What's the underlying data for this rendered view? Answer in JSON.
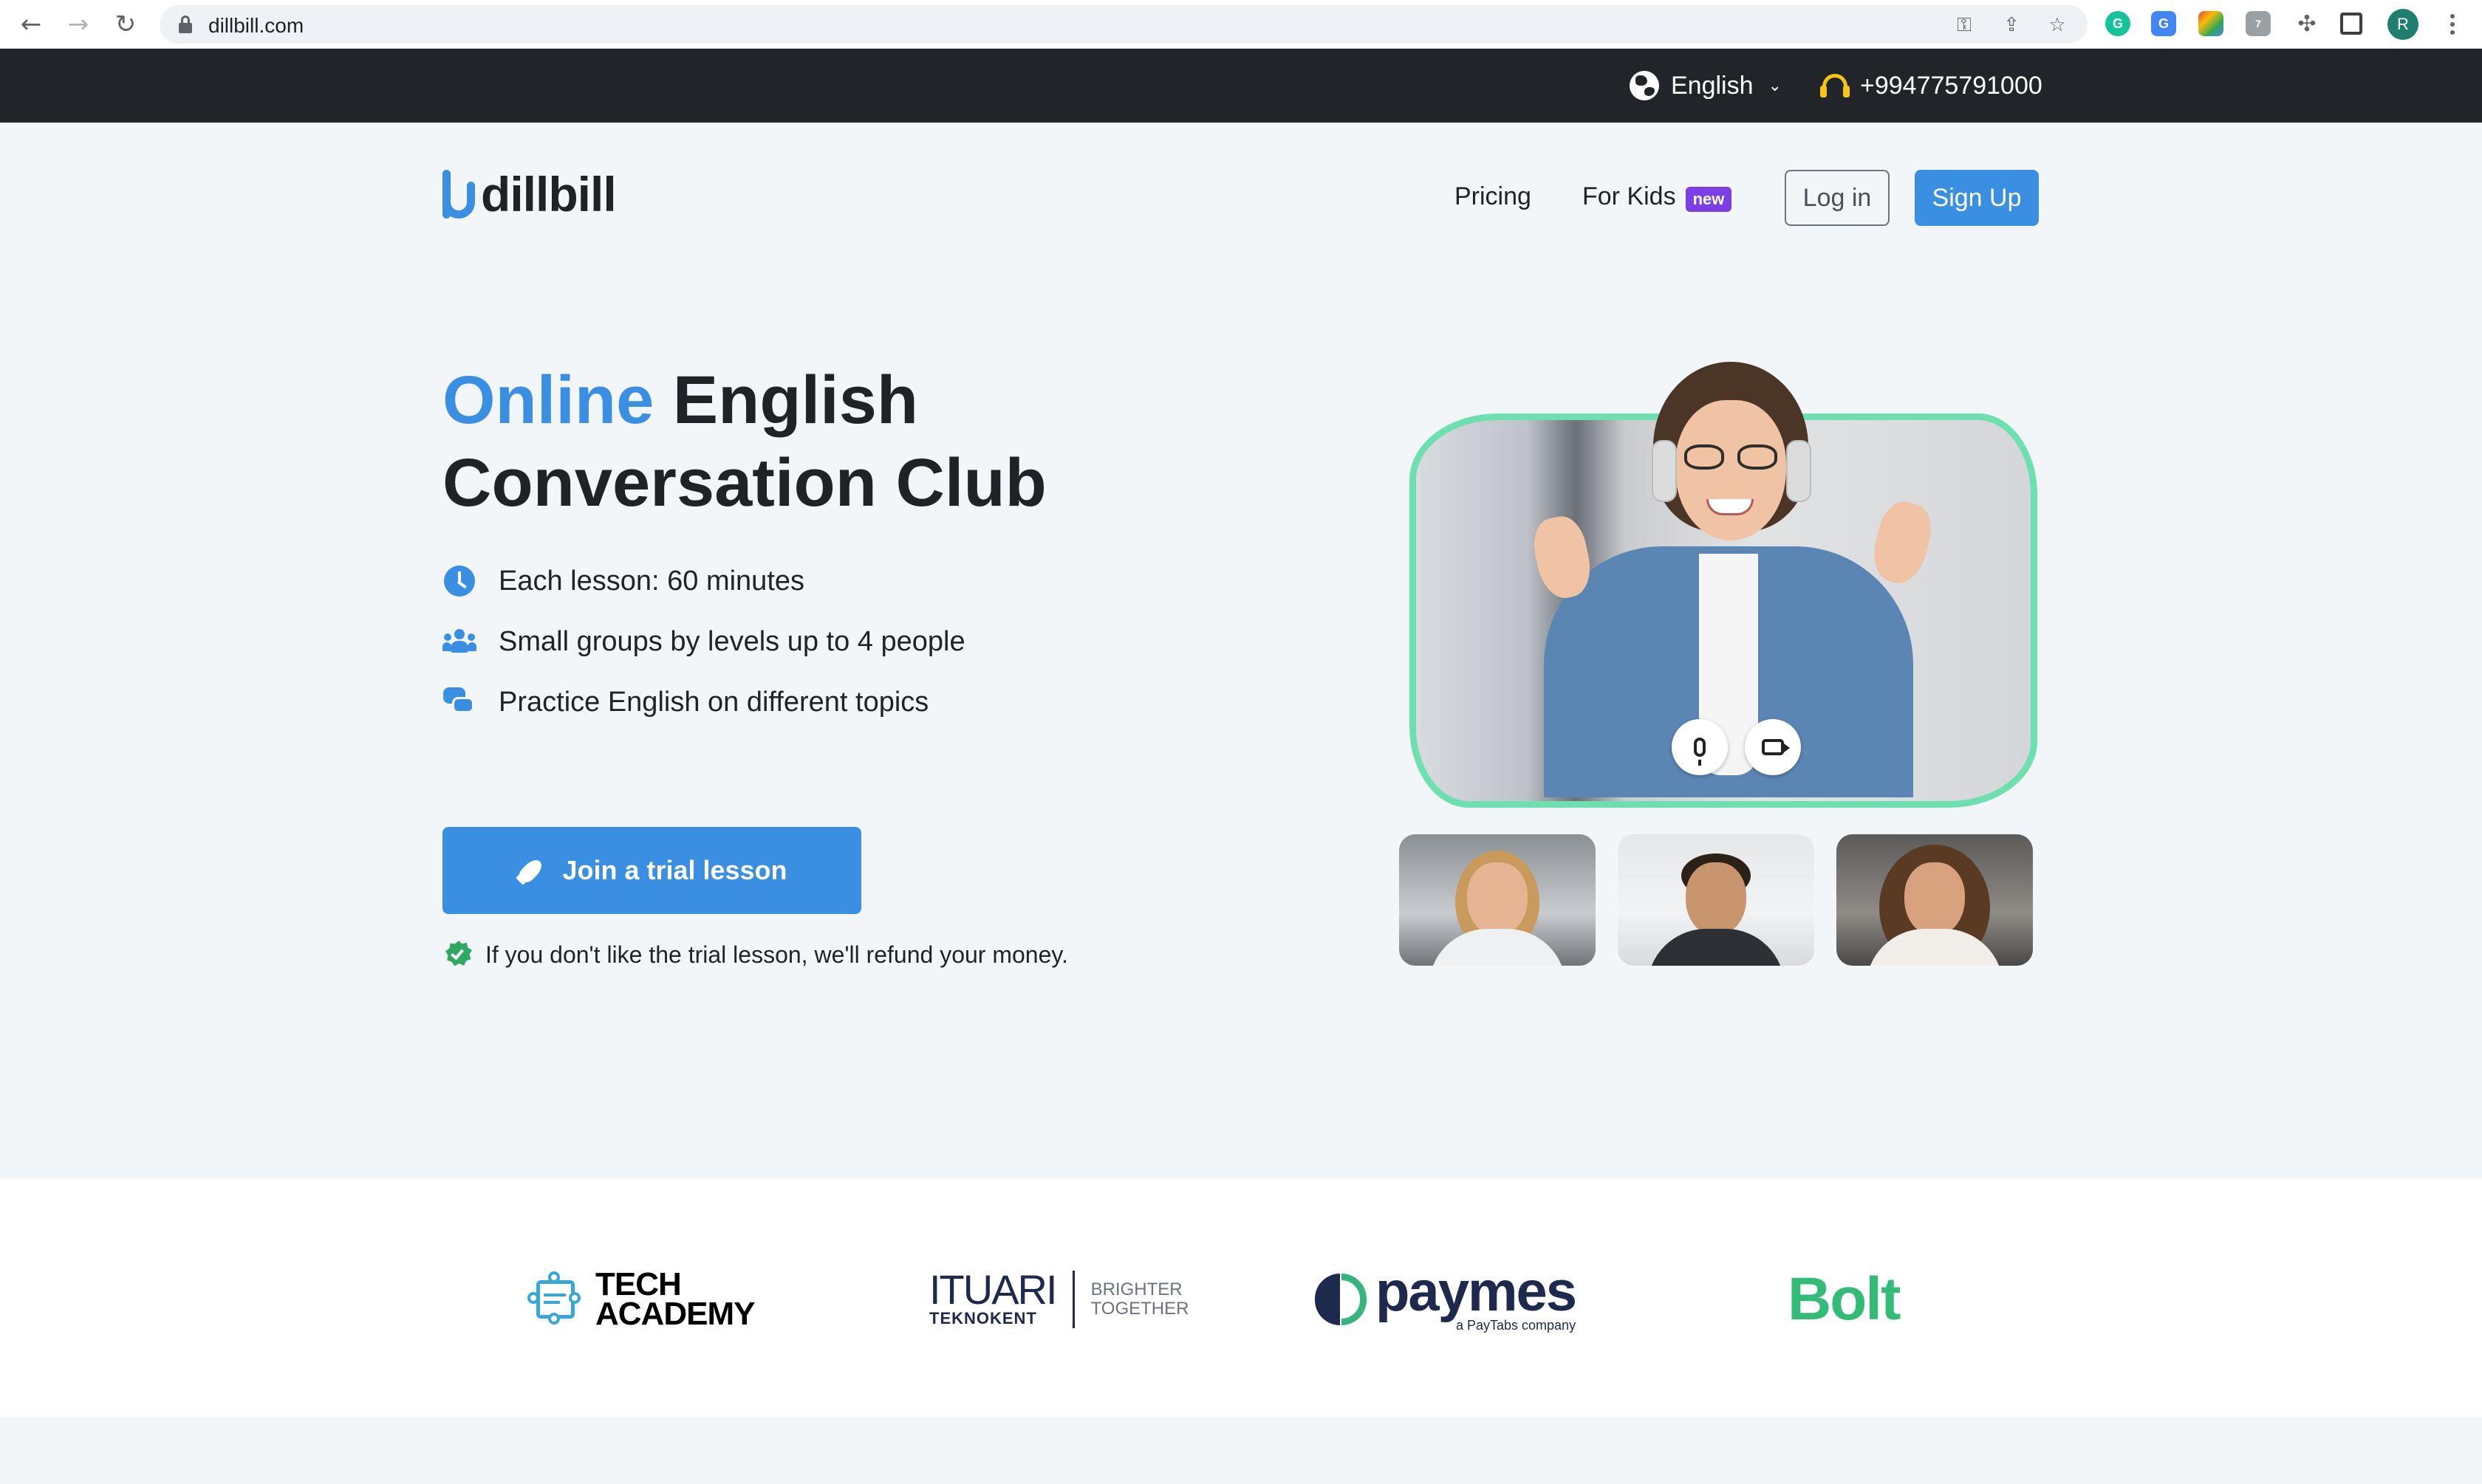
{
  "browser": {
    "url": "dillbill.com",
    "profile_initial": "R",
    "extensions": [
      {
        "name": "grammarly-extension",
        "color": "#15c39a",
        "label": "G"
      },
      {
        "name": "translate-extension",
        "color": "#4285f4",
        "label": "G"
      },
      {
        "name": "color-picker-extension",
        "color": "#e94235",
        "label": ""
      },
      {
        "name": "ghost-extension",
        "color": "#9aa0a6",
        "label": "7"
      },
      {
        "name": "puzzle-extension",
        "color": "#5f6368",
        "label": ""
      }
    ]
  },
  "topbar": {
    "language": "English",
    "phone": "+994775791000"
  },
  "header": {
    "logo_text": "dillbill",
    "nav": {
      "pricing": "Pricing",
      "for_kids": "For Kids",
      "new_badge": "new"
    },
    "login": "Log in",
    "signup": "Sign Up"
  },
  "hero": {
    "title_accent": "Online",
    "title_rest_line1": " English",
    "title_line2": "Conversation Club",
    "features": [
      {
        "icon": "clock-icon",
        "text": "Each lesson: 60 minutes"
      },
      {
        "icon": "users-icon",
        "text": "Small groups by levels up to 4 people"
      },
      {
        "icon": "chat-icon",
        "text": "Practice English on different topics"
      }
    ],
    "cta": "Join a trial lesson",
    "guarantee": "If you don't like the trial lesson, we'll refund your money."
  },
  "colors": {
    "accent": "#3b8fe3",
    "topbar": "#212529",
    "frame": "#6ee0b0",
    "badge": "#7b3fe4"
  },
  "partners": {
    "tech_academy_line1": "TECH",
    "tech_academy_line2": "ACADEMY",
    "itu_top": "ITUARI",
    "itu_sub": "TEKNOKENT",
    "itu_tag1": "BRIGHTER",
    "itu_tag2": "TOGETHER",
    "paymes": "paymes",
    "paymes_sub": "a PayTabs company",
    "bolt": "Bolt"
  }
}
